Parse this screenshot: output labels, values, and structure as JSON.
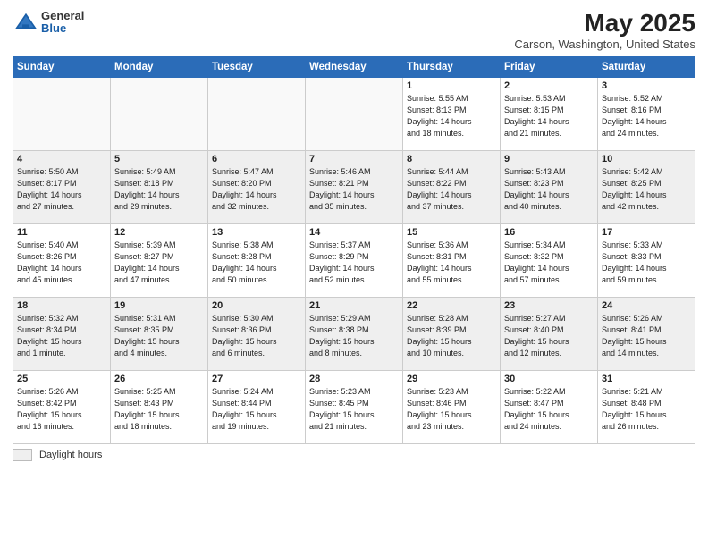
{
  "header": {
    "logo_general": "General",
    "logo_blue": "Blue",
    "title": "May 2025",
    "subtitle": "Carson, Washington, United States"
  },
  "days_of_week": [
    "Sunday",
    "Monday",
    "Tuesday",
    "Wednesday",
    "Thursday",
    "Friday",
    "Saturday"
  ],
  "legend_label": "Daylight hours",
  "weeks": [
    [
      {
        "day": "",
        "info": ""
      },
      {
        "day": "",
        "info": ""
      },
      {
        "day": "",
        "info": ""
      },
      {
        "day": "",
        "info": ""
      },
      {
        "day": "1",
        "info": "Sunrise: 5:55 AM\nSunset: 8:13 PM\nDaylight: 14 hours\nand 18 minutes."
      },
      {
        "day": "2",
        "info": "Sunrise: 5:53 AM\nSunset: 8:15 PM\nDaylight: 14 hours\nand 21 minutes."
      },
      {
        "day": "3",
        "info": "Sunrise: 5:52 AM\nSunset: 8:16 PM\nDaylight: 14 hours\nand 24 minutes."
      }
    ],
    [
      {
        "day": "4",
        "info": "Sunrise: 5:50 AM\nSunset: 8:17 PM\nDaylight: 14 hours\nand 27 minutes."
      },
      {
        "day": "5",
        "info": "Sunrise: 5:49 AM\nSunset: 8:18 PM\nDaylight: 14 hours\nand 29 minutes."
      },
      {
        "day": "6",
        "info": "Sunrise: 5:47 AM\nSunset: 8:20 PM\nDaylight: 14 hours\nand 32 minutes."
      },
      {
        "day": "7",
        "info": "Sunrise: 5:46 AM\nSunset: 8:21 PM\nDaylight: 14 hours\nand 35 minutes."
      },
      {
        "day": "8",
        "info": "Sunrise: 5:44 AM\nSunset: 8:22 PM\nDaylight: 14 hours\nand 37 minutes."
      },
      {
        "day": "9",
        "info": "Sunrise: 5:43 AM\nSunset: 8:23 PM\nDaylight: 14 hours\nand 40 minutes."
      },
      {
        "day": "10",
        "info": "Sunrise: 5:42 AM\nSunset: 8:25 PM\nDaylight: 14 hours\nand 42 minutes."
      }
    ],
    [
      {
        "day": "11",
        "info": "Sunrise: 5:40 AM\nSunset: 8:26 PM\nDaylight: 14 hours\nand 45 minutes."
      },
      {
        "day": "12",
        "info": "Sunrise: 5:39 AM\nSunset: 8:27 PM\nDaylight: 14 hours\nand 47 minutes."
      },
      {
        "day": "13",
        "info": "Sunrise: 5:38 AM\nSunset: 8:28 PM\nDaylight: 14 hours\nand 50 minutes."
      },
      {
        "day": "14",
        "info": "Sunrise: 5:37 AM\nSunset: 8:29 PM\nDaylight: 14 hours\nand 52 minutes."
      },
      {
        "day": "15",
        "info": "Sunrise: 5:36 AM\nSunset: 8:31 PM\nDaylight: 14 hours\nand 55 minutes."
      },
      {
        "day": "16",
        "info": "Sunrise: 5:34 AM\nSunset: 8:32 PM\nDaylight: 14 hours\nand 57 minutes."
      },
      {
        "day": "17",
        "info": "Sunrise: 5:33 AM\nSunset: 8:33 PM\nDaylight: 14 hours\nand 59 minutes."
      }
    ],
    [
      {
        "day": "18",
        "info": "Sunrise: 5:32 AM\nSunset: 8:34 PM\nDaylight: 15 hours\nand 1 minute."
      },
      {
        "day": "19",
        "info": "Sunrise: 5:31 AM\nSunset: 8:35 PM\nDaylight: 15 hours\nand 4 minutes."
      },
      {
        "day": "20",
        "info": "Sunrise: 5:30 AM\nSunset: 8:36 PM\nDaylight: 15 hours\nand 6 minutes."
      },
      {
        "day": "21",
        "info": "Sunrise: 5:29 AM\nSunset: 8:38 PM\nDaylight: 15 hours\nand 8 minutes."
      },
      {
        "day": "22",
        "info": "Sunrise: 5:28 AM\nSunset: 8:39 PM\nDaylight: 15 hours\nand 10 minutes."
      },
      {
        "day": "23",
        "info": "Sunrise: 5:27 AM\nSunset: 8:40 PM\nDaylight: 15 hours\nand 12 minutes."
      },
      {
        "day": "24",
        "info": "Sunrise: 5:26 AM\nSunset: 8:41 PM\nDaylight: 15 hours\nand 14 minutes."
      }
    ],
    [
      {
        "day": "25",
        "info": "Sunrise: 5:26 AM\nSunset: 8:42 PM\nDaylight: 15 hours\nand 16 minutes."
      },
      {
        "day": "26",
        "info": "Sunrise: 5:25 AM\nSunset: 8:43 PM\nDaylight: 15 hours\nand 18 minutes."
      },
      {
        "day": "27",
        "info": "Sunrise: 5:24 AM\nSunset: 8:44 PM\nDaylight: 15 hours\nand 19 minutes."
      },
      {
        "day": "28",
        "info": "Sunrise: 5:23 AM\nSunset: 8:45 PM\nDaylight: 15 hours\nand 21 minutes."
      },
      {
        "day": "29",
        "info": "Sunrise: 5:23 AM\nSunset: 8:46 PM\nDaylight: 15 hours\nand 23 minutes."
      },
      {
        "day": "30",
        "info": "Sunrise: 5:22 AM\nSunset: 8:47 PM\nDaylight: 15 hours\nand 24 minutes."
      },
      {
        "day": "31",
        "info": "Sunrise: 5:21 AM\nSunset: 8:48 PM\nDaylight: 15 hours\nand 26 minutes."
      }
    ]
  ]
}
